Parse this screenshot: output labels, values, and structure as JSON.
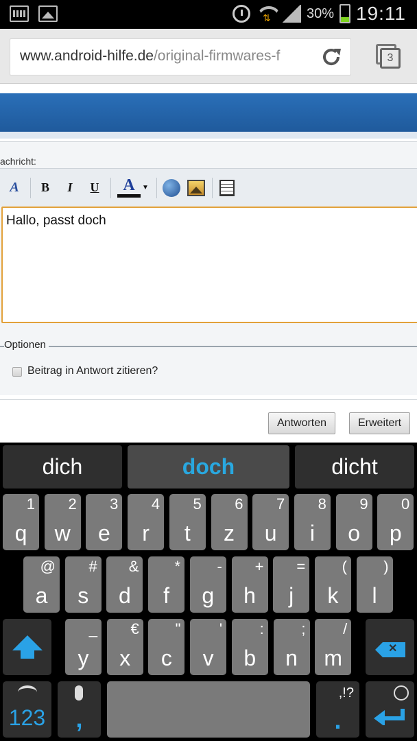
{
  "status_bar": {
    "battery": "30%",
    "time": "19:11"
  },
  "browser": {
    "url_host": "www.android-hilfe.de",
    "url_path": "/original-firmwares-f",
    "tab_count": "3"
  },
  "form": {
    "message_label": "achricht:",
    "toolbar": {
      "bold": "B",
      "italic": "I",
      "underline": "U",
      "text_color": "A"
    },
    "editor_text": "Hallo, passt doch",
    "options_legend": "Optionen",
    "quote_label": "Beitrag in Antwort zitieren?",
    "reply_button": "Antworten",
    "advanced_button": "Erweitert"
  },
  "keyboard": {
    "suggestions": [
      "dich",
      "doch",
      "dicht"
    ],
    "row1": [
      {
        "main": "q",
        "alt": "1"
      },
      {
        "main": "w",
        "alt": "2"
      },
      {
        "main": "e",
        "alt": "3"
      },
      {
        "main": "r",
        "alt": "4"
      },
      {
        "main": "t",
        "alt": "5"
      },
      {
        "main": "z",
        "alt": "6"
      },
      {
        "main": "u",
        "alt": "7"
      },
      {
        "main": "i",
        "alt": "8"
      },
      {
        "main": "o",
        "alt": "9"
      },
      {
        "main": "p",
        "alt": "0"
      }
    ],
    "row2": [
      {
        "main": "a",
        "alt": "@"
      },
      {
        "main": "s",
        "alt": "#"
      },
      {
        "main": "d",
        "alt": "&"
      },
      {
        "main": "f",
        "alt": "*"
      },
      {
        "main": "g",
        "alt": "-"
      },
      {
        "main": "h",
        "alt": "+"
      },
      {
        "main": "j",
        "alt": "="
      },
      {
        "main": "k",
        "alt": "("
      },
      {
        "main": "l",
        "alt": ")"
      }
    ],
    "row3": [
      {
        "main": "y",
        "alt": "_"
      },
      {
        "main": "x",
        "alt": "€"
      },
      {
        "main": "c",
        "alt": "\""
      },
      {
        "main": "v",
        "alt": "'"
      },
      {
        "main": "b",
        "alt": ":"
      },
      {
        "main": "n",
        "alt": ";"
      },
      {
        "main": "m",
        "alt": "/"
      }
    ],
    "numbers_key": "123",
    "comma_key": ",",
    "period_key": ".",
    "punct_alt": ",!?"
  },
  "colors": {
    "accent_blue": "#2aa2e6",
    "header_blue": "#2a6fb8",
    "editor_border": "#e2a13a"
  }
}
